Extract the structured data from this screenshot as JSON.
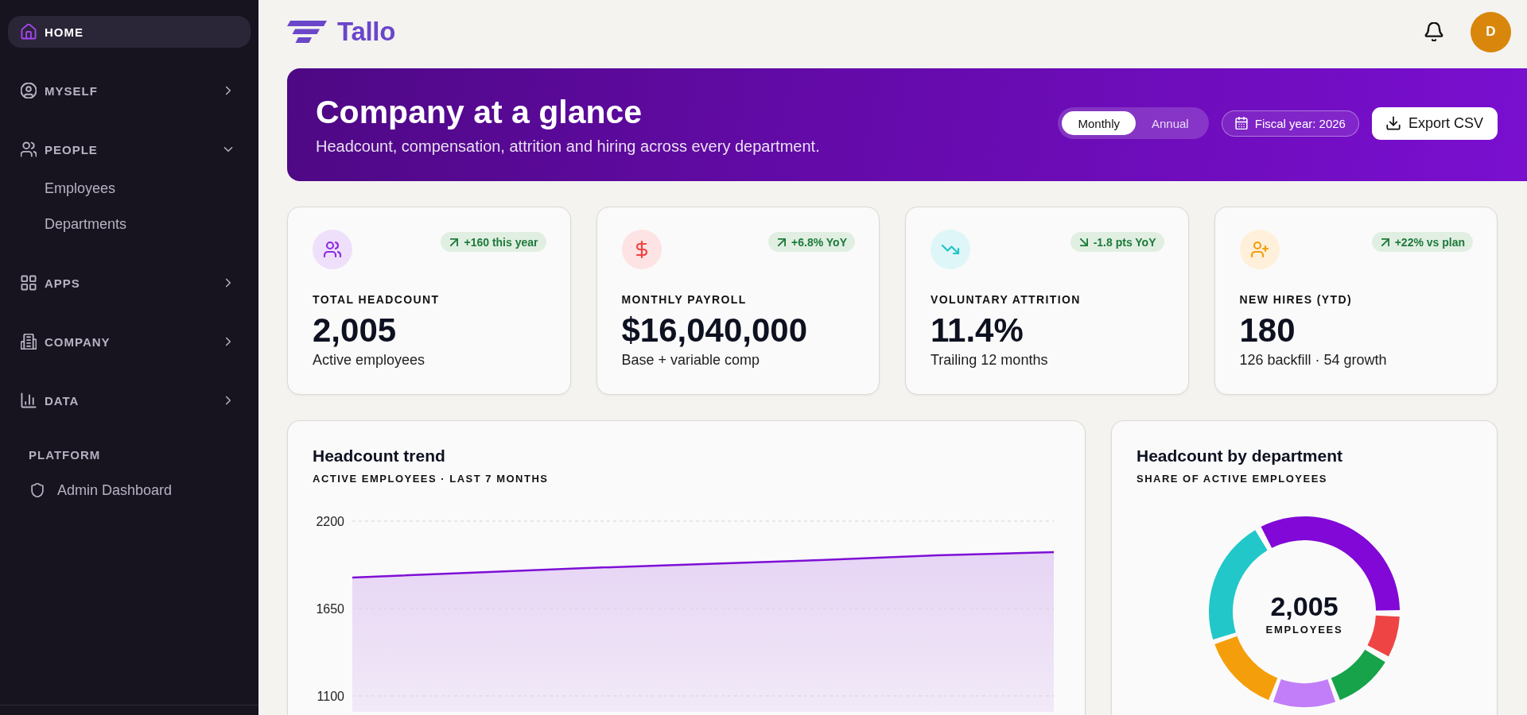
{
  "sidebar": {
    "items": [
      {
        "label": "HOME",
        "selected": true
      },
      {
        "label": "MYSELF",
        "selected": false,
        "expanded": false
      },
      {
        "label": "PEOPLE",
        "selected": false,
        "expanded": true,
        "children": [
          {
            "label": "Employees",
            "selected": false
          },
          {
            "label": "Departments",
            "selected": false
          }
        ]
      },
      {
        "label": "APPS",
        "selected": false,
        "expanded": false
      },
      {
        "label": "COMPANY",
        "selected": false,
        "expanded": false
      },
      {
        "label": "DATA",
        "selected": false,
        "expanded": false
      }
    ],
    "sections": [
      {
        "heading": "PLATFORM",
        "items": [
          {
            "label": "Admin Dashboard",
            "selected": false
          }
        ]
      }
    ]
  },
  "topbar": {
    "brand": "Tallo",
    "avatar": "D"
  },
  "banner": {
    "title": "Company at a glance",
    "subtitle": "Headcount, compensation, attrition and hiring across every department.",
    "period_options": [
      {
        "label": "Monthly",
        "selected": true
      },
      {
        "label": "Annual",
        "selected": false
      }
    ],
    "fiscal_year": "Fiscal year: 2026",
    "export_button": "Export CSV"
  },
  "kpis": [
    {
      "label": "TOTAL HEADCOUNT",
      "value": "2,005",
      "caption": "Active employees",
      "trend": "+160 this year",
      "kind": "up"
    },
    {
      "label": "MONTHLY PAYROLL",
      "value": "$16,040,000",
      "caption": "Base + variable comp",
      "trend": "+6.8% YoY",
      "kind": "up"
    },
    {
      "label": "VOLUNTARY ATTRITION",
      "value": "11.4%",
      "caption": "Trailing 12 months",
      "trend": "-1.8 pts YoY",
      "kind": "down"
    },
    {
      "label": "NEW HIRES (YTD)",
      "value": "180",
      "caption": "126 backfill · 54 growth",
      "trend": "+22% vs plan",
      "kind": "up"
    }
  ],
  "headcount_trend": {
    "title": "Headcount trend",
    "subtitle": "ACTIVE EMPLOYEES · LAST 7 MONTHS",
    "chart_data": {
      "type": "area",
      "ylim": [
        1000,
        2200
      ],
      "yticks": [
        1100,
        1650,
        2200
      ],
      "series": [
        {
          "color": "#7e0fd6",
          "values": [
            1845,
            1875,
            1905,
            1930,
            1955,
            1985,
            2005
          ]
        }
      ]
    }
  },
  "headcount_by_department": {
    "title": "Headcount by department",
    "subtitle": "SHARE OF ACTIVE EMPLOYEES",
    "total": "2,005",
    "total_label": "EMPLOYEES",
    "slices": [
      {
        "color": "#8108d6"
      },
      {
        "color": "#ef4444"
      },
      {
        "color": "#16a34a"
      },
      {
        "color": "#c27ef8"
      },
      {
        "color": "#f59e0b"
      },
      {
        "color": "#22c7c9"
      }
    ]
  }
}
